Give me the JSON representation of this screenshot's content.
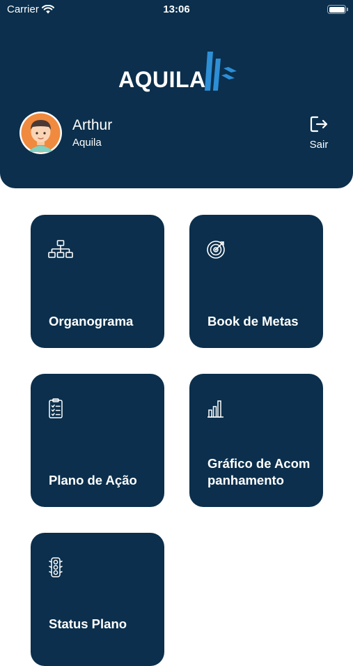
{
  "status_bar": {
    "carrier": "Carrier",
    "time": "13:06"
  },
  "header": {
    "logo_text": "AQUILA",
    "background_color": "#0b2f4c",
    "accent_color": "#2d8fd6"
  },
  "user": {
    "name": "Arthur",
    "company": "Aquila",
    "logout_label": "Sair",
    "logout_icon": "logout-icon"
  },
  "menu": [
    {
      "label": "Organograma",
      "icon": "org-chart-icon"
    },
    {
      "label": "Book de Metas",
      "icon": "target-icon"
    },
    {
      "label": "Plano de Ação",
      "icon": "clipboard-checklist-icon"
    },
    {
      "label": "Gráfico de Acompanhamento",
      "icon": "bar-chart-icon"
    },
    {
      "label": "Status Plano",
      "icon": "traffic-light-icon"
    }
  ]
}
